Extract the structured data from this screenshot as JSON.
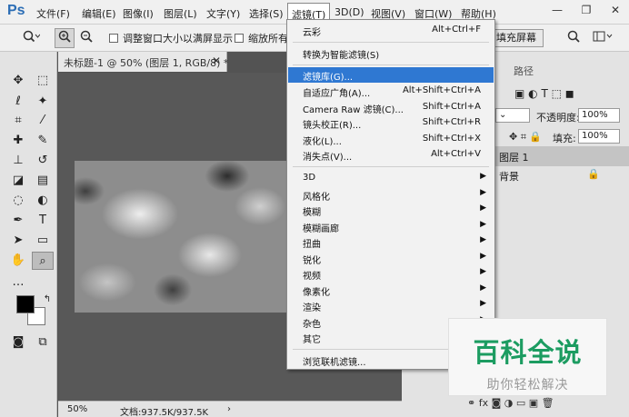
{
  "app": {
    "logo": "Ps"
  },
  "menubar": {
    "items": [
      "文件(F)",
      "编辑(E)",
      "图像(I)",
      "图层(L)",
      "文字(Y)",
      "选择(S)",
      "滤镜(T)",
      "3D(D)",
      "视图(V)",
      "窗口(W)",
      "帮助(H)"
    ],
    "active": "滤镜(T)"
  },
  "window_controls": {
    "minimize": "—",
    "restore": "❐",
    "close": "✕"
  },
  "options_bar": {
    "zoom_tool": "zoom-tool-menu",
    "resize_windows_label": "调整窗口大小以满屏显示",
    "zoom_all_label": "缩放所有窗口",
    "fill_screen_button": "填充屏幕"
  },
  "document": {
    "tab_title": "未标题-1 @ 50% (图层 1, RGB/8) *",
    "zoom": "50%",
    "doc_size": "文档:937.5K/937.5K"
  },
  "panels": {
    "paths_tab": "路径",
    "opacity_label": "不透明度:",
    "opacity_value": "100%",
    "fill_label": "填充:",
    "fill_value": "100%",
    "layers": [
      {
        "name": "图层 1"
      },
      {
        "name": "背景"
      }
    ]
  },
  "filter_menu": {
    "groups": [
      [
        {
          "label": "云彩",
          "shortcut": "Alt+Ctrl+F"
        }
      ],
      [
        {
          "label": "转换为智能滤镜(S)",
          "shortcut": ""
        }
      ],
      [
        {
          "label": "滤镜库(G)...",
          "shortcut": "",
          "highlighted": true
        },
        {
          "label": "自适应广角(A)...",
          "shortcut": "Alt+Shift+Ctrl+A"
        },
        {
          "label": "Camera Raw 滤镜(C)...",
          "shortcut": "Shift+Ctrl+A"
        },
        {
          "label": "镜头校正(R)...",
          "shortcut": "Shift+Ctrl+R"
        },
        {
          "label": "液化(L)...",
          "shortcut": "Shift+Ctrl+X"
        },
        {
          "label": "消失点(V)...",
          "shortcut": "Alt+Ctrl+V"
        }
      ],
      [
        {
          "label": "3D",
          "submenu": true
        },
        {
          "label": "风格化",
          "submenu": true
        },
        {
          "label": "模糊",
          "submenu": true
        },
        {
          "label": "模糊画廊",
          "submenu": true
        },
        {
          "label": "扭曲",
          "submenu": true
        },
        {
          "label": "锐化",
          "submenu": true
        },
        {
          "label": "视频",
          "submenu": true
        },
        {
          "label": "像素化",
          "submenu": true
        },
        {
          "label": "渲染",
          "submenu": true
        },
        {
          "label": "杂色",
          "submenu": true
        },
        {
          "label": "其它",
          "submenu": true
        }
      ],
      [
        {
          "label": "浏览联机滤镜...",
          "shortcut": ""
        }
      ]
    ]
  },
  "watermark": {
    "title": "百科全说",
    "subtitle": "助你轻松解决"
  },
  "colors": {
    "accent_highlight": "#2f78d2",
    "watermark_green": "#1c9c61",
    "foreground": "#000000",
    "background": "#ffffff"
  }
}
